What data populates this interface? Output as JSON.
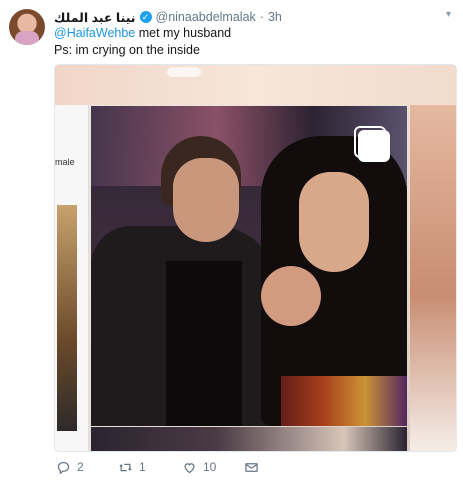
{
  "tweet": {
    "display_name": "نينا عبد الملك",
    "handle": "@ninaabdelmalak",
    "separator": "·",
    "time": "3h",
    "mention": "@HaifaWehbe",
    "text_after_mention": " met my husband",
    "line2": "Ps: im crying on the inside",
    "caret_icon": "chevron-down-icon"
  },
  "media": {
    "left_label": "male"
  },
  "actions": {
    "reply_count": "2",
    "retweet_count": "1",
    "like_count": "10"
  },
  "colors": {
    "link": "#1b95e0",
    "verified": "#1da1f2",
    "meta": "#657786"
  }
}
